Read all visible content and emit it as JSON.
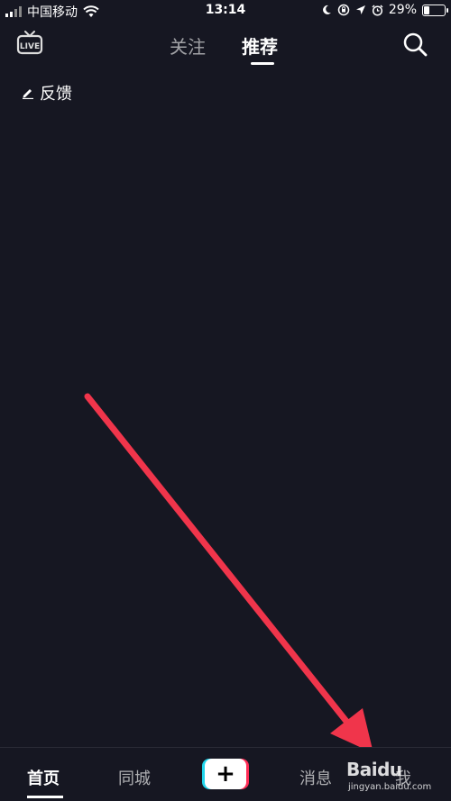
{
  "status_bar": {
    "carrier": "中国移动",
    "time": "13:14",
    "battery_percent": "29%",
    "battery_level": 0.29
  },
  "top_nav": {
    "live_icon": "live-tv-icon",
    "live_label": "LIVE",
    "tabs": [
      {
        "label": "关注",
        "active": false
      },
      {
        "label": "推荐",
        "active": true
      }
    ],
    "search_icon": "search-icon"
  },
  "feedback": {
    "label": "反馈",
    "icon": "pencil-icon"
  },
  "bottom_nav": {
    "items": [
      {
        "label": "首页",
        "active": true
      },
      {
        "label": "同城",
        "active": false
      },
      {
        "label": "+",
        "active": false
      },
      {
        "label": "消息",
        "active": false
      },
      {
        "label": "我",
        "active": false
      }
    ]
  },
  "annotation": {
    "arrow_color": "#f0354b"
  },
  "watermark": {
    "logo_text": "Baidu",
    "site": "jingyan.baidu.com"
  },
  "colors": {
    "background": "#161722",
    "accent_cyan": "#20d5ec",
    "accent_pink": "#fe2c55"
  }
}
